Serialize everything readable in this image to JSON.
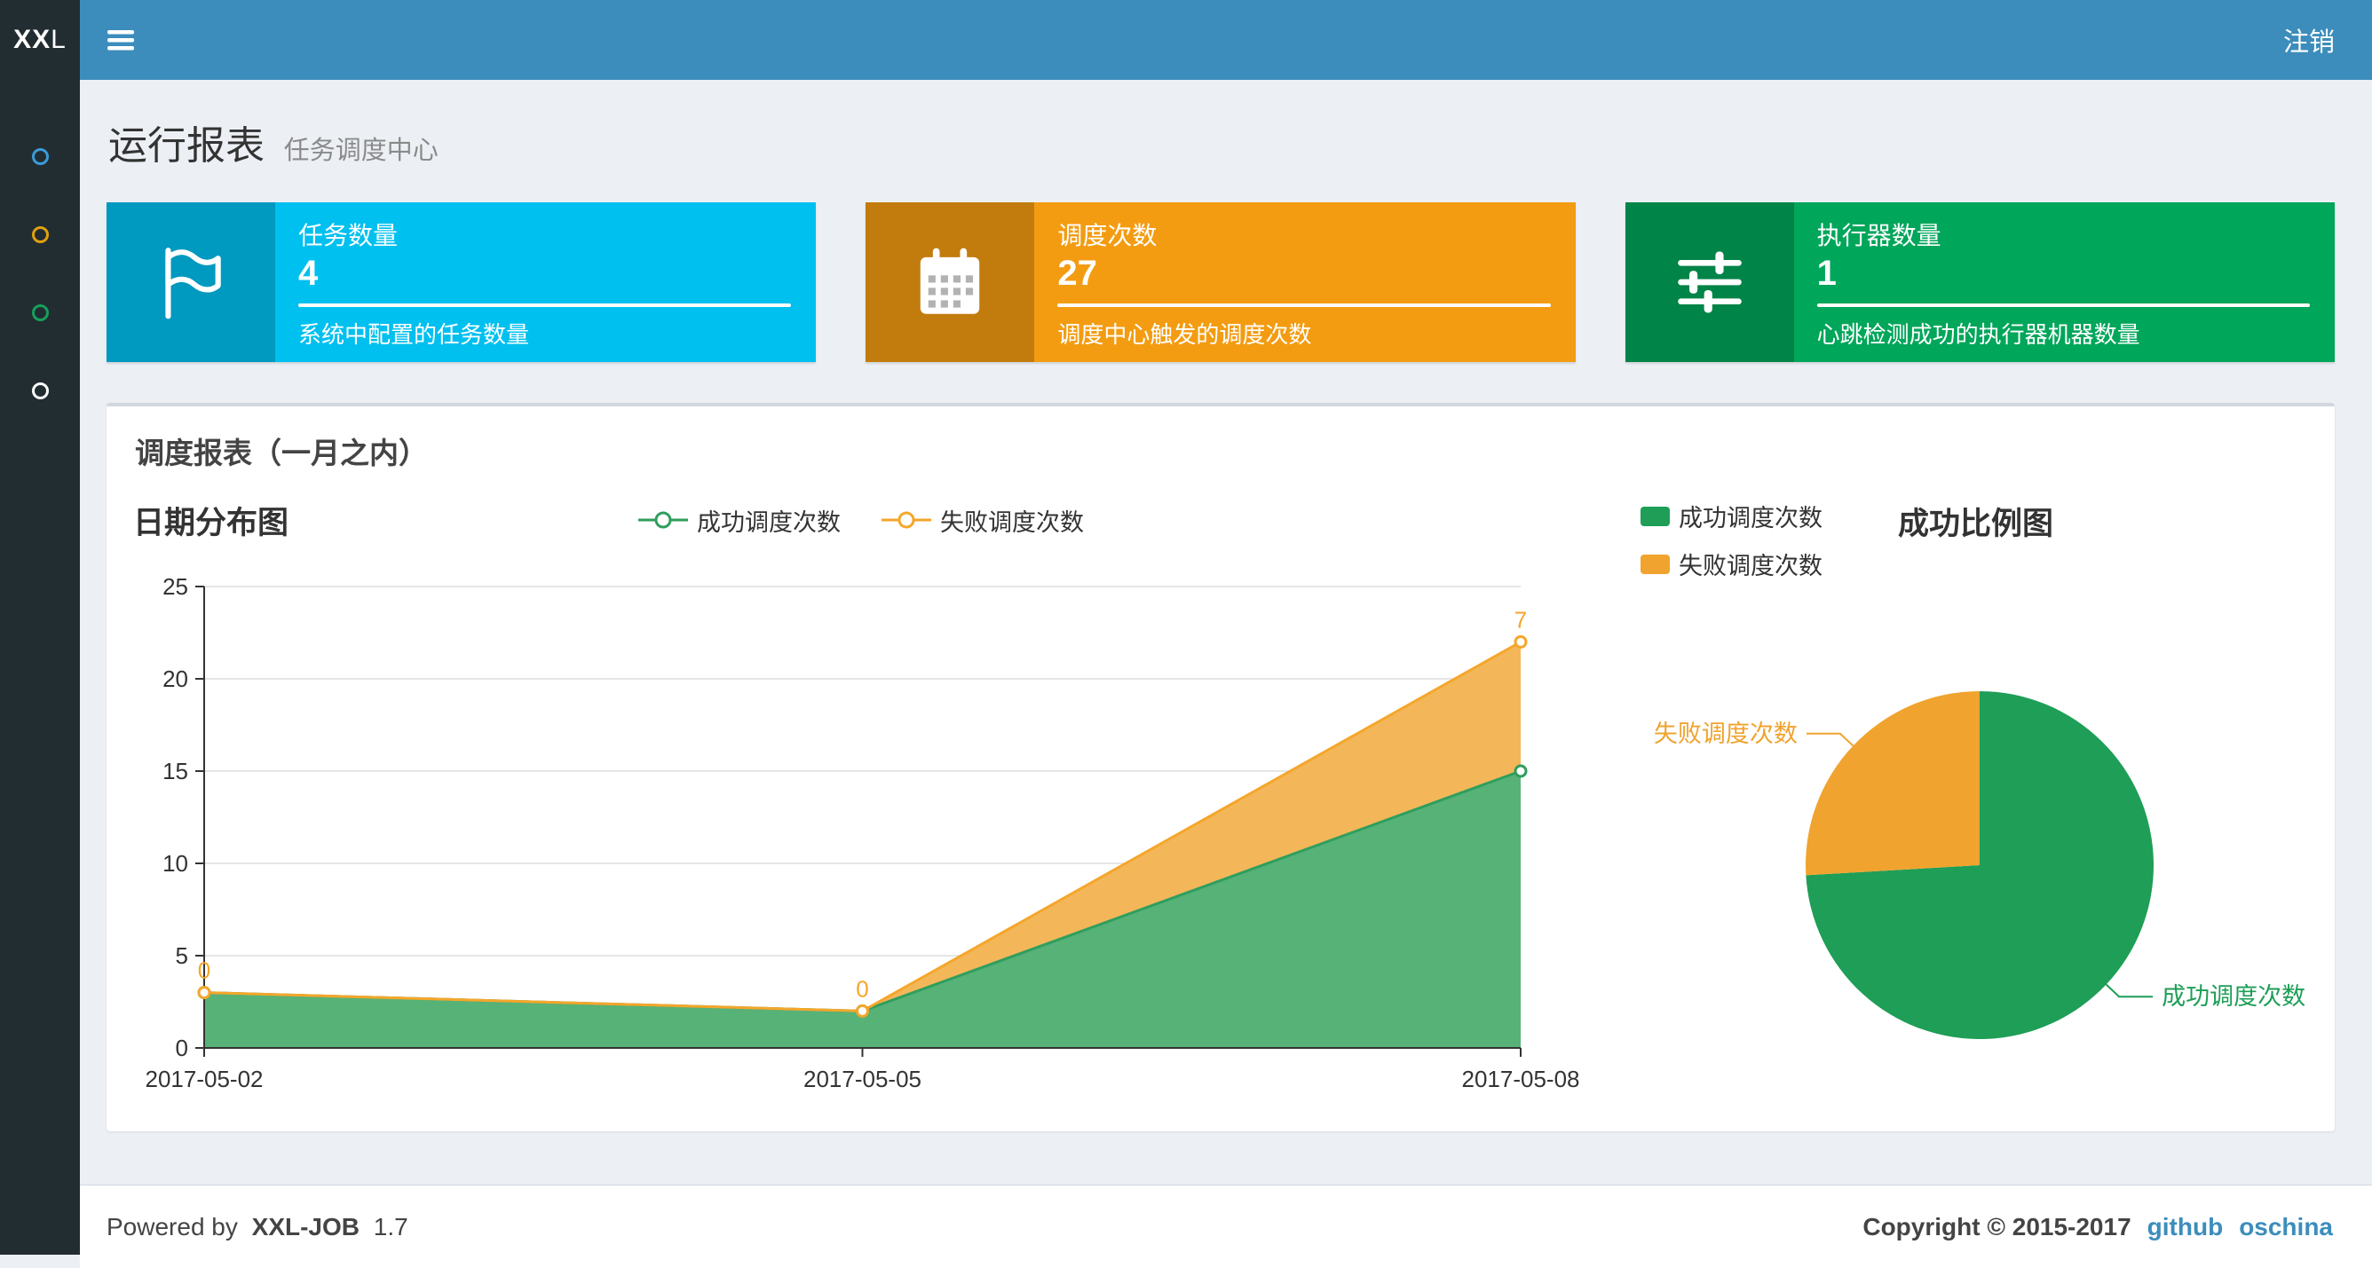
{
  "app": {
    "logo_bold": "XX",
    "logo_light": "L",
    "logout_label": "注销"
  },
  "sidebar": {
    "items": [
      {
        "name": "menu-item-1",
        "color": "#3c9ad9"
      },
      {
        "name": "menu-item-2",
        "color": "#e0a10d"
      },
      {
        "name": "menu-item-3",
        "color": "#16a05c"
      },
      {
        "name": "menu-item-4",
        "color": "#ffffff"
      }
    ]
  },
  "page": {
    "title": "运行报表",
    "subtitle": "任务调度中心"
  },
  "info_boxes": [
    {
      "label": "任务数量",
      "value": "4",
      "description": "系统中配置的任务数量",
      "bg": "#00c0ef",
      "icon": "flag-icon"
    },
    {
      "label": "调度次数",
      "value": "27",
      "description": "调度中心触发的调度次数",
      "bg": "#f39c12",
      "icon": "calendar-icon"
    },
    {
      "label": "执行器数量",
      "value": "1",
      "description": "心跳检测成功的执行器机器数量",
      "bg": "#00a65a",
      "icon": "sliders-icon"
    }
  ],
  "panel": {
    "title": "调度报表（一月之内）"
  },
  "chart_data": [
    {
      "type": "area",
      "title": "日期分布图",
      "x": [
        "2017-05-02",
        "2017-05-05",
        "2017-05-08"
      ],
      "series": [
        {
          "name": "成功调度次数",
          "values": [
            3,
            2,
            15
          ],
          "color": "#2f9e5e",
          "fill": "#57b277",
          "stacked": true
        },
        {
          "name": "失败调度次数",
          "values": [
            0,
            0,
            7
          ],
          "color": "#f5a62b",
          "fill": "#f3b75a",
          "stacked": true,
          "point_labels": [
            "0",
            "0",
            "7"
          ]
        }
      ],
      "ylim": [
        0,
        25
      ],
      "yticks": [
        0,
        5,
        10,
        15,
        20,
        25
      ],
      "xlabel": "",
      "ylabel": "",
      "grid": true,
      "legend_position": "top-center"
    },
    {
      "type": "pie",
      "title": "成功比例图",
      "slices": [
        {
          "label": "成功调度次数",
          "value": 20,
          "color": "#1e9e57"
        },
        {
          "label": "失败调度次数",
          "value": 7,
          "color": "#f0a32e"
        }
      ],
      "start_angle_deg": 90,
      "clockwise": true,
      "legend_position": "top-left"
    }
  ],
  "footer": {
    "powered_prefix": "Powered by",
    "product": "XXL-JOB",
    "version": "1.7",
    "copyright": "Copyright © 2015-2017",
    "links": [
      {
        "label": "github"
      },
      {
        "label": "oschina"
      }
    ]
  }
}
